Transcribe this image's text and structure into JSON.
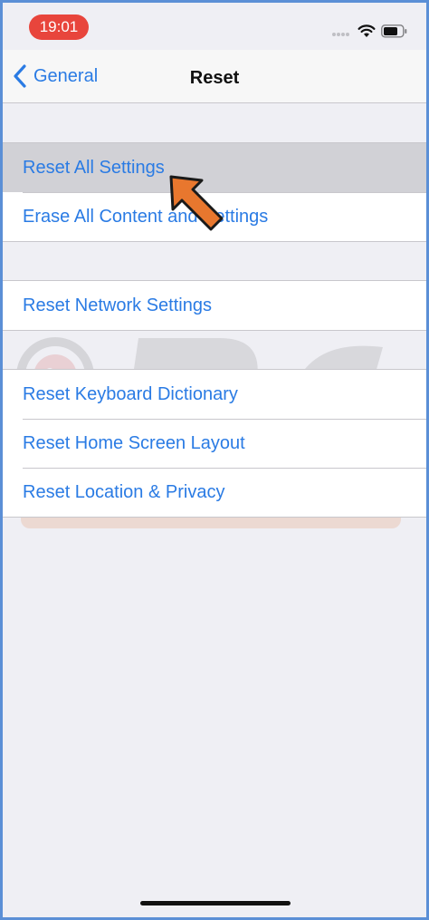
{
  "status_bar": {
    "time": "19:01",
    "icons": [
      "signal-dots-icon",
      "wifi-icon",
      "battery-icon"
    ]
  },
  "nav": {
    "back_label": "General",
    "title": "Reset"
  },
  "groups": [
    {
      "items": [
        {
          "label": "Reset All Settings",
          "highlighted": true
        },
        {
          "label": "Erase All Content and Settings",
          "highlighted": false
        }
      ]
    },
    {
      "items": [
        {
          "label": "Reset Network Settings",
          "highlighted": false
        }
      ]
    },
    {
      "items": [
        {
          "label": "Reset Keyboard Dictionary",
          "highlighted": false
        },
        {
          "label": "Reset Home Screen Layout",
          "highlighted": false
        },
        {
          "label": "Reset Location & Privacy",
          "highlighted": false
        }
      ]
    }
  ],
  "annotation": {
    "icon": "orange-pointer-arrow-icon",
    "color": "#e8772e"
  },
  "colors": {
    "accent": "#2a7be4",
    "time_pill": "#e8453c",
    "background": "#efeff4",
    "highlight": "#d1d1d6"
  }
}
